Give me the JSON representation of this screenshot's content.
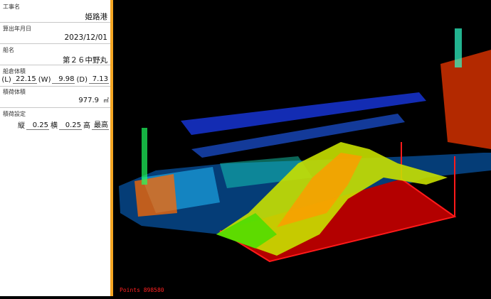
{
  "fields": {
    "project_label": "工事名",
    "project_value": "姫路港",
    "date_label": "算出年月日",
    "date_value": "2023/12/01",
    "ship_label": "船名",
    "ship_value": "第２６中野丸",
    "hold_label": "船倉体積",
    "hold_L_label": "(L)",
    "hold_L": "22.15",
    "hold_W_label": "(W)",
    "hold_W": "9.98",
    "hold_D_label": "(D)",
    "hold_D": "7.13",
    "load_volume_label": "積荷体積",
    "load_volume_value": "977.9",
    "load_volume_unit": "㎥",
    "load_setting_label": "積荷設定",
    "vertical_label": "縦",
    "vertical_value": "0.25",
    "horizontal_label": "横",
    "horizontal_value": "0.25",
    "height_label": "高",
    "max_label": "最高"
  },
  "viewer": {
    "points_text": "Points 898580"
  },
  "colors": {
    "accent": "#f5a623",
    "hold_box": "#b30000",
    "hold_edge": "#ff1a1a"
  }
}
